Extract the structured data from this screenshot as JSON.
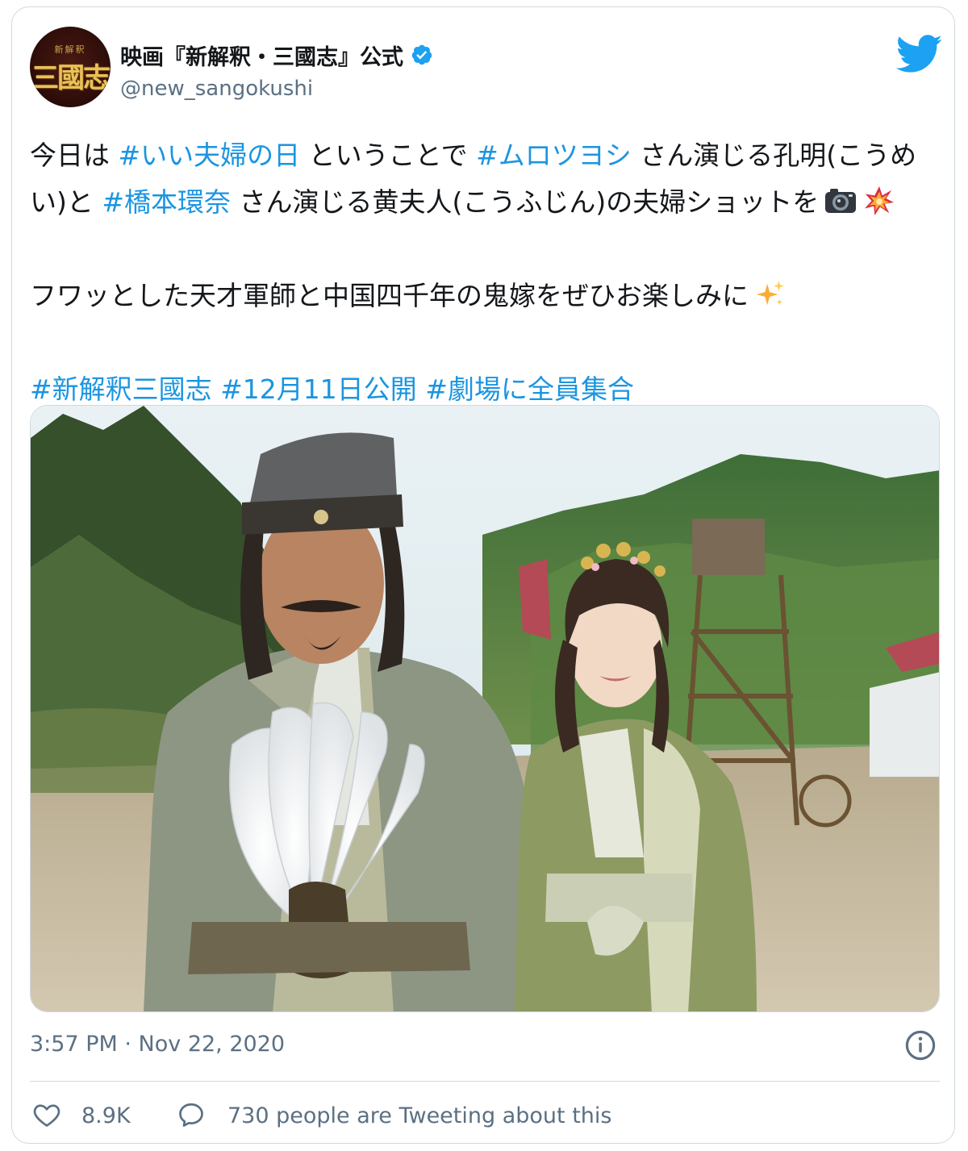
{
  "author": {
    "avatar_small_text": "新解釈",
    "avatar_text": "三國志",
    "name": "映画『新解釈・三國志』公式",
    "handle": "@new_sangokushi",
    "verified": true
  },
  "tweet": {
    "line1": {
      "t1": "今日は ",
      "h1": "#いい夫婦の日",
      "t2": " ということで ",
      "h2": "#ムロツヨシ",
      "t3": " さん演じる孔明(こうめい)と ",
      "h3": "#橋本環奈",
      "t4": " さん演じる黄夫人(こうふじん)の夫婦ショットを"
    },
    "line2": "フワッとした天才軍師と中国四千年の鬼嫁をぜひお楽しみに",
    "hashtags": [
      "#新解釈三國志",
      "#12月11日公開",
      "#劇場に全員集合"
    ]
  },
  "emojis": [
    "camera-emoji",
    "collision-emoji",
    "sparkles-emoji"
  ],
  "timestamp": "3:57 PM · Nov 22, 2020",
  "stats": {
    "likes": "8.9K",
    "conversation": "730 people are Tweeting about this"
  },
  "colors": {
    "hashtag": "#1b95e0",
    "twitter_blue": "#1da1f2",
    "secondary_text": "#5b7083",
    "border": "#cfd9de"
  }
}
